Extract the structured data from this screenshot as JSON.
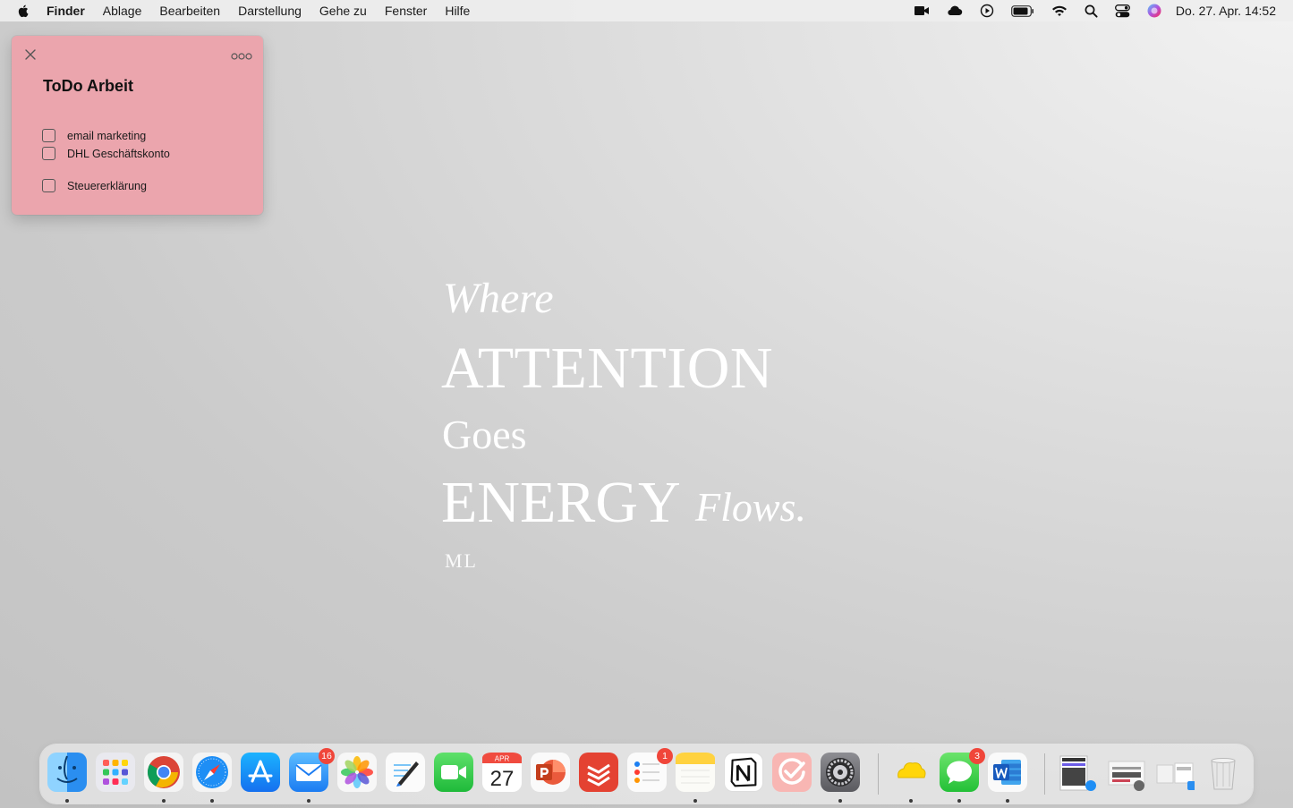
{
  "menubar": {
    "app_name": "Finder",
    "items": [
      "Ablage",
      "Bearbeiten",
      "Darstellung",
      "Gehe zu",
      "Fenster",
      "Hilfe"
    ],
    "clock": "Do. 27. Apr.  14:52",
    "status_icons": [
      "camera-icon",
      "cloud-icon",
      "play-icon",
      "battery-icon",
      "wifi-icon",
      "search-icon",
      "control-center-icon",
      "siri-icon"
    ]
  },
  "note": {
    "title": "ToDo Arbeit",
    "items": [
      {
        "label": "email marketing",
        "checked": false
      },
      {
        "label": "DHL Geschäftskonto",
        "checked": false
      },
      {
        "label": "Steuererklärung",
        "checked": false
      }
    ],
    "color": "#eba5ad"
  },
  "wallpaper": {
    "line1": "Where",
    "line2": "ATTENTION",
    "line3": "Goes",
    "line4": "ENERGY",
    "line4_italic": "Flows.",
    "signature": "ML"
  },
  "dock": {
    "apps": [
      {
        "name": "Finder",
        "running": true
      },
      {
        "name": "Launchpad",
        "running": false
      },
      {
        "name": "Google Chrome",
        "running": true
      },
      {
        "name": "Safari",
        "running": true
      },
      {
        "name": "App Store",
        "running": false
      },
      {
        "name": "Mail",
        "running": true,
        "badge": "16"
      },
      {
        "name": "Fotos",
        "running": false
      },
      {
        "name": "Freeform",
        "running": false
      },
      {
        "name": "FaceTime",
        "running": false
      },
      {
        "name": "Kalender",
        "running": false,
        "month": "APR",
        "day": "27"
      },
      {
        "name": "PowerPoint",
        "running": false
      },
      {
        "name": "Todoist",
        "running": false
      },
      {
        "name": "Erinnerungen",
        "running": false,
        "badge": "1"
      },
      {
        "name": "Notizen",
        "running": true
      },
      {
        "name": "Notion",
        "running": false
      },
      {
        "name": "TickTick",
        "running": false
      },
      {
        "name": "Systemeinstellungen",
        "running": true
      },
      {
        "name": "Stickies",
        "running": true
      },
      {
        "name": "Nachrichten",
        "running": true,
        "badge": "3"
      },
      {
        "name": "Word",
        "running": true
      }
    ]
  }
}
